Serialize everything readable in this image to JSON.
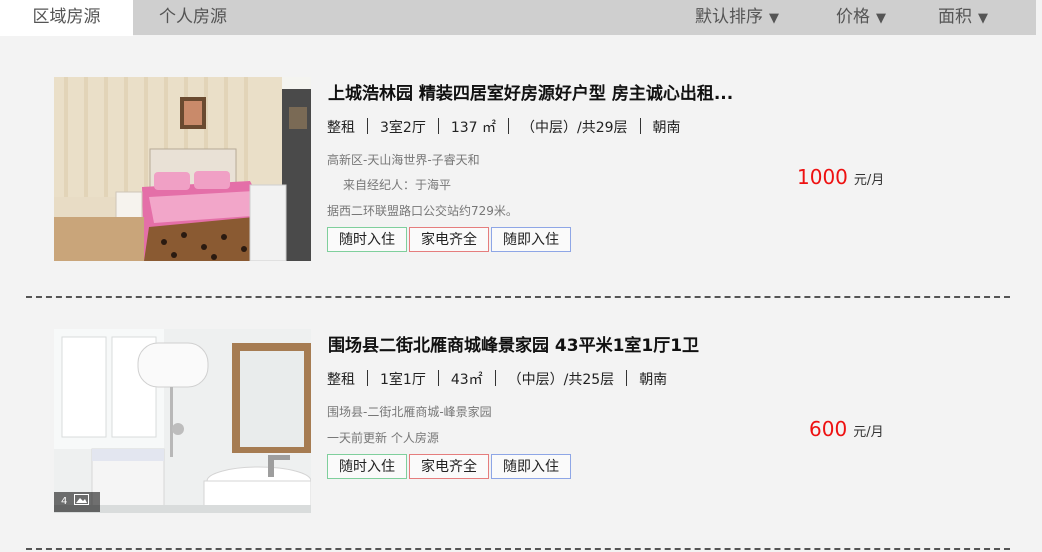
{
  "tabs": [
    {
      "label": "区域房源"
    },
    {
      "label": "个人房源"
    }
  ],
  "sorts": [
    {
      "label": "默认排序"
    },
    {
      "label": "价格"
    },
    {
      "label": "面积"
    }
  ],
  "listings": [
    {
      "title": "上城浩林园 精装四居室好房源好户型 房主诚心出租...",
      "type": "整租",
      "layout": "3室2厅",
      "area": "137 ㎡",
      "floor": "（中层）/共29层",
      "orientation": "朝南",
      "location": "高新区-天山海世界-子睿天和",
      "agent": "来自经纪人：于海平",
      "transit": "据西二环联盟路口公交站约729米。",
      "tags": [
        "随时入住",
        "家电齐全",
        "随即入住"
      ],
      "price": "1000",
      "price_unit": "元/月"
    },
    {
      "title": "围场县二街北雁商城峰景家园 43平米1室1厅1卫",
      "type": "整租",
      "layout": "1室1厅",
      "area": "43㎡",
      "floor": "（中层）/共25层",
      "orientation": "朝南",
      "location": "围场县-二街北雁商城-峰景家园",
      "update": "一天前更新 个人房源",
      "tags": [
        "随时入住",
        "家电齐全",
        "随即入住"
      ],
      "price": "600",
      "price_unit": "元/月",
      "photo_count": "4"
    }
  ]
}
